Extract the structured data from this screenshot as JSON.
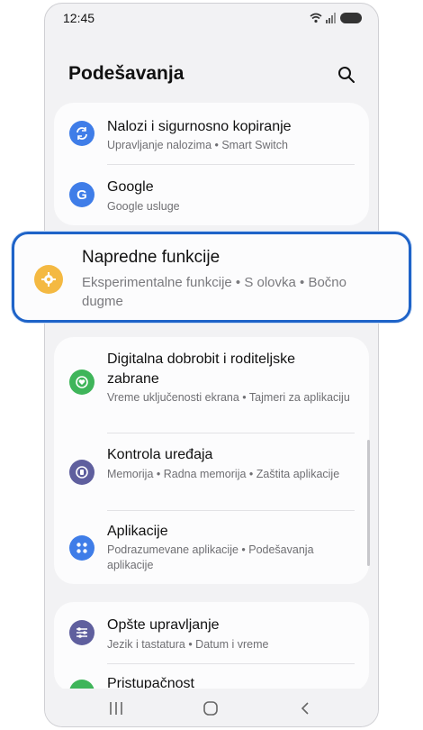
{
  "status_bar": {
    "time": "12:45"
  },
  "header": {
    "title": "Podešavanja"
  },
  "groups": [
    {
      "items": [
        {
          "title": "Nalozi i sigurnosno kopiranje",
          "subtitle": "Upravljanje nalozima  •  Smart Switch",
          "icon": "sync-icon",
          "color": "#3f7de8"
        },
        {
          "title": "Google",
          "subtitle": "Google usluge",
          "icon": "google-icon",
          "color": "#3f7de8"
        }
      ]
    },
    {
      "items": [
        {
          "title": "Digitalna dobrobit i roditeljske zabrane",
          "subtitle": "Vreme uključenosti ekrana  •  Tajmeri za aplikaciju",
          "icon": "wellbeing-icon",
          "color": "#3fb55a"
        },
        {
          "title": "Kontrola uređaja",
          "subtitle": "Memorija  •  Radna memorija  •  Zaštita aplikacije",
          "icon": "device-care-icon",
          "color": "#5f5f9e"
        },
        {
          "title": "Aplikacije",
          "subtitle": "Podrazumevane aplikacije  •  Podešavanja aplikacije",
          "icon": "apps-icon",
          "color": "#3f7de8"
        }
      ]
    },
    {
      "items": [
        {
          "title": "Opšte upravljanje",
          "subtitle": "Jezik i tastatura  •  Datum i vreme",
          "icon": "sliders-icon",
          "color": "#5f5f9e"
        },
        {
          "title": "Pristupačnost",
          "subtitle": "",
          "icon": "accessibility-icon",
          "color": "#3fb55a"
        }
      ]
    }
  ],
  "highlighted": {
    "title": "Napredne funkcije",
    "subtitle_line1": "Eksperimentalne funkcije  •  S olovka  •  Bočno",
    "subtitle_line2": "dugme",
    "icon": "gear-plus-icon",
    "color": "#f4b942",
    "outline_color": "#1e63c8"
  },
  "nav": {
    "buttons": [
      "recents-icon",
      "home-icon",
      "back-icon"
    ]
  }
}
